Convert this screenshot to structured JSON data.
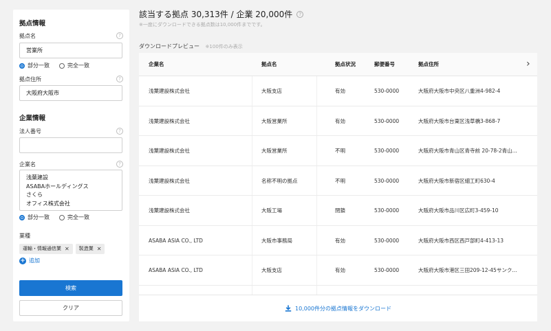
{
  "sidebar": {
    "location_section_title": "拠点情報",
    "location_name_label": "拠点名",
    "location_name_value": "営業所",
    "match_options": [
      "部分一致",
      "完全一致"
    ],
    "location_address_label": "拠点住所",
    "location_address_value": "大阪府大阪市",
    "company_section_title": "企業情報",
    "corporate_number_label": "法人番号",
    "corporate_number_value": "",
    "company_name_label": "企業名",
    "company_name_lines": [
      "浅葉建設",
      "ASABAホールディングス",
      "さくら",
      "オフィス株式会社"
    ],
    "industry_label": "業種",
    "industry_tags": [
      "運輸・情報通信業",
      "製造業"
    ],
    "add_label": "追加",
    "search_button": "検索",
    "clear_button": "クリア"
  },
  "main": {
    "title": "該当する拠点 30,313件 / 企業 20,000件",
    "note": "※一度にダウンロードできる拠点数は10,000件までです。",
    "preview_label": "ダウンロードプレビュー",
    "preview_sub": "※100件のみ表示",
    "columns": [
      "企業名",
      "拠点名",
      "拠点状況",
      "郵便番号",
      "拠点住所"
    ],
    "rows": [
      [
        "浅葉建設株式会社",
        "大阪支店",
        "有効",
        "530-0000",
        "大阪府大阪市中央区八重洲4-982-4"
      ],
      [
        "浅葉建設株式会社",
        "大阪営業所",
        "有効",
        "530-0000",
        "大阪府大阪市台東区浅草橋3-868-7"
      ],
      [
        "浅葉建設株式会社",
        "大阪営業所",
        "不明",
        "530-0000",
        "大阪府大阪市青山区青寺前 20-78-2青山..."
      ],
      [
        "浅葉建設株式会社",
        "名称不明の拠点",
        "不明",
        "530-0000",
        "大阪府大阪市新宿区細工町630-4"
      ],
      [
        "浅葉建設株式会社",
        "大阪工場",
        "閉鎖",
        "530-0000",
        "大阪府大阪市品川区広町3-459-10"
      ],
      [
        "ASABA ASIA CO., LTD",
        "大阪市事務局",
        "有効",
        "530-0000",
        "大阪府大阪市西区西戸部町4-413-13"
      ],
      [
        "ASABA ASIA CO., LTD",
        "大阪支店",
        "有効",
        "530-0000",
        "大阪府大阪市港区三田209-12-45サンク..."
      ]
    ],
    "download_label": "10,000件分の拠点情報をダウンロード"
  },
  "colors": {
    "primary": "#1976d2",
    "background": "#f2f2f2"
  }
}
